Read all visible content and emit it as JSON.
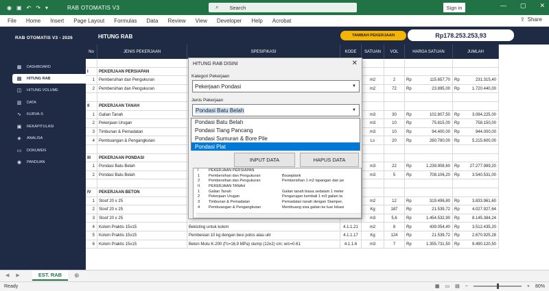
{
  "titlebar": {
    "app_title": "RAB OTOMATIS V3",
    "search_placeholder": "Search",
    "signin_label": "Sign in",
    "min_glyph": "—",
    "max_glyph": "▢",
    "close_glyph": "✕"
  },
  "menu": [
    "File",
    "Home",
    "Insert",
    "Page Layout",
    "Formulas",
    "Data",
    "Review",
    "View",
    "Developer",
    "Help",
    "Acrobat"
  ],
  "share_label": "Share",
  "sidebar": {
    "title": "RAB OTOMATIS V3 - 2026",
    "items": [
      {
        "label": "DASHBOARD",
        "icon": "dashboard-icon",
        "glyph": "▦"
      },
      {
        "label": "HITUNG RAB",
        "icon": "calculator-icon",
        "glyph": "▤"
      },
      {
        "label": "HITUNG VOLUME",
        "icon": "cube-icon",
        "glyph": "◫"
      },
      {
        "label": "DATA",
        "icon": "database-icon",
        "glyph": "▥"
      },
      {
        "label": "KURVA-S",
        "icon": "chart-icon",
        "glyph": "∿"
      },
      {
        "label": "REKAPITULASI",
        "icon": "summary-icon",
        "glyph": "▣"
      },
      {
        "label": "ANALISA",
        "icon": "analysis-icon",
        "glyph": "◈"
      },
      {
        "label": "DOKUMEN",
        "icon": "document-icon",
        "glyph": "▭"
      },
      {
        "label": "PANDUAN",
        "icon": "help-icon",
        "glyph": "◉"
      }
    ]
  },
  "header": {
    "title": "HITUNG RAB",
    "tambah_label": "TAMBAH PEKERJAAN",
    "total": "Rp178.253.253,93"
  },
  "columns": {
    "no": "No",
    "jenis": "JENIS PEKERJAAN",
    "spek": "SPESIFIKASI",
    "kode": "KODE",
    "satuan": "SATUAN",
    "vol": "VOL",
    "harga": "HARGA SATUAN",
    "jumlah": "JUMLAH"
  },
  "rows": [
    {
      "no": "",
      "jenis": "",
      "spek": "",
      "kode": "",
      "sat": "",
      "vol": "",
      "rp1": "",
      "harga": "",
      "rp2": "",
      "jumlah": ""
    },
    {
      "no": "I",
      "jenis": "PEKERJAAN PERSIAPAN",
      "section": true
    },
    {
      "no": "1",
      "jenis": "Pembersihan dan Pengukuran",
      "spek": "",
      "kode": "",
      "sat": "m2",
      "vol": "2",
      "rp1": "Rp",
      "harga": "115.657,70",
      "rp2": "Rp",
      "jumlah": "231.315,40"
    },
    {
      "no": "2",
      "jenis": "Pembersihan dan Pengukuran",
      "spek": "",
      "kode": "",
      "sat": "m2",
      "vol": "72",
      "rp1": "Rp",
      "harga": "23.895,00",
      "rp2": "Rp",
      "jumlah": "1.720.440,00"
    },
    {
      "no": "",
      "jenis": "",
      "spek": "",
      "kode": "",
      "sat": "",
      "vol": "",
      "rp1": "",
      "harga": "",
      "rp2": "",
      "jumlah": ""
    },
    {
      "no": "II",
      "jenis": "PEKERJAAN TANAH",
      "section": true
    },
    {
      "no": "1",
      "jenis": "Galian Tanah",
      "spek": "",
      "kode": "",
      "sat": "m3",
      "vol": "30",
      "rp1": "Rp",
      "harga": "102.807,50",
      "rp2": "Rp",
      "jumlah": "3.084.225,00"
    },
    {
      "no": "2",
      "jenis": "Pekerjaan Urugan",
      "spek": "",
      "kode": "",
      "sat": "m3",
      "vol": "10",
      "rp1": "Rp",
      "harga": "75.815,00",
      "rp2": "Rp",
      "jumlah": "758.150,00"
    },
    {
      "no": "3",
      "jenis": "Timbunan & Pemadatan",
      "spek": "",
      "kode": "",
      "sat": "m3",
      "vol": "10",
      "rp1": "Rp",
      "harga": "94.400,00",
      "rp2": "Rp",
      "jumlah": "944.000,00"
    },
    {
      "no": "4",
      "jenis": "Pembuangan & Pengangkutan",
      "spek": "",
      "kode": "",
      "sat": "Ls",
      "vol": "20",
      "rp1": "Rp",
      "harga": "260.780,00",
      "rp2": "Rp",
      "jumlah": "5.215.600,00"
    },
    {
      "no": "",
      "jenis": "",
      "spek": "",
      "kode": "",
      "sat": "",
      "vol": "",
      "rp1": "",
      "harga": "",
      "rp2": "",
      "jumlah": ""
    },
    {
      "no": "III",
      "jenis": "PEKERJAAN PONDASI",
      "section": true
    },
    {
      "no": "1",
      "jenis": "Pondasi Batu Belah",
      "spek": "",
      "kode": "",
      "sat": "m3",
      "vol": "22",
      "rp1": "Rp",
      "harga": "1.239.908,60",
      "rp2": "Rp",
      "jumlah": "27.277.989,20"
    },
    {
      "no": "2",
      "jenis": "Pondasi Batu Belah",
      "spek": "",
      "kode": "",
      "sat": "m3",
      "vol": "5",
      "rp1": "Rp",
      "harga": "708.106,20",
      "rp2": "Rp",
      "jumlah": "3.540.531,00"
    },
    {
      "no": "",
      "jenis": "",
      "spek": "",
      "kode": "",
      "sat": "",
      "vol": "",
      "rp1": "",
      "harga": "",
      "rp2": "",
      "jumlah": ""
    },
    {
      "no": "IV",
      "jenis": "PEKERJAAN BETON",
      "section": true
    },
    {
      "no": "1",
      "jenis": "Sloof  20 x 25",
      "spek": "",
      "kode": "",
      "sat": "m2",
      "vol": "12",
      "rp1": "Rp",
      "harga": "319.496,80",
      "rp2": "Rp",
      "jumlah": "3.833.961,60"
    },
    {
      "no": "2",
      "jenis": "Sloof  20 x 25",
      "spek": "",
      "kode": "",
      "sat": "Kg",
      "vol": "187",
      "rp1": "Rp",
      "harga": "21.539,72",
      "rp2": "Rp",
      "jumlah": "4.027.927,64"
    },
    {
      "no": "3",
      "jenis": "Sloof  20 x 25",
      "spek": "",
      "kode": "",
      "sat": "m3",
      "vol": "5,6",
      "rp1": "Rp",
      "harga": "1.454.532,90",
      "rp2": "Rp",
      "jumlah": "8.145.384,24"
    },
    {
      "no": "4",
      "jenis": "Kolom Praktis 15x15",
      "spek": "Bekisting untuk kolom",
      "kode": "4.1.1.21",
      "sat": "m2",
      "vol": "8",
      "rp1": "Rp",
      "harga": "439.054,40",
      "rp2": "Rp",
      "jumlah": "3.512.435,20"
    },
    {
      "no": "5",
      "jenis": "Kolom Praktis 15x15",
      "spek": "Pembesian 10 kg dengan besi polos atau ulir",
      "kode": "4.1.1.17",
      "sat": "Kg",
      "vol": "124",
      "rp1": "Rp",
      "harga": "21.539,72",
      "rp2": "Rp",
      "jumlah": "2.670.925,28"
    },
    {
      "no": "6",
      "jenis": "Kolom Praktis 15x15",
      "spek": "Beton Mutu K-200 (f'c=16,9 MPa) slump (12±2) cm; w/c=0.61",
      "kode": "4.1.1.6",
      "sat": "m3",
      "vol": "7",
      "rp1": "Rp",
      "harga": "1.355.731,50",
      "rp2": "Rp",
      "jumlah": "9.490.120,50"
    }
  ],
  "dialog": {
    "title": "HITUNG RAB DISINI",
    "close_glyph": "✕",
    "kategori_label": "Kategori Pekerjaan",
    "kategori_value": "Pekerjaan Pondasi",
    "jenis_label": "Jenis Pekerjaan",
    "jenis_value": "Pondasi Batu Belah",
    "options": [
      "Pondasi Batu Belah",
      "Pondasi Tiang Pancang",
      "Pondasi Sumuran & Bore Pile",
      "Pondasi Plat"
    ],
    "selected_option": 3,
    "input_label": "INPUT DATA",
    "hapus_label": "HAPUS DATA",
    "preview": [
      {
        "a": "I",
        "b": "PEKERJAAN PERSIAPAN",
        "c": ""
      },
      {
        "a": "1",
        "b": "Pembersihan dan Pengukuran",
        "c": "Bouwplank"
      },
      {
        "a": "2",
        "b": "Pembersihan dan Pengukuran",
        "c": "Pembersihan 1 m2 lapangan dan pe"
      },
      {
        "a": "II",
        "b": "PEKERJAAN TANAH",
        "c": ""
      },
      {
        "a": "1",
        "b": "Galian Tanah",
        "c": "Galian tanah biasa sedalam 1 meter"
      },
      {
        "a": "2",
        "b": "Pekerjaan Urugan",
        "c": "Pengurugan kembali 1 m3 galian ta"
      },
      {
        "a": "3",
        "b": "Timbunan & Pemadatan",
        "c": "Pemadatan tanah dengan Stamper,"
      },
      {
        "a": "4",
        "b": "Pembuangan & Pengangkutan",
        "c": "Membuang sisa galian ke luar lokasi"
      },
      {
        "a": "",
        "b": "",
        "c": ""
      }
    ]
  },
  "sheet_tab": "EST. RAB",
  "status": {
    "ready": "Ready",
    "zoom": "80%"
  },
  "colors": {
    "excel_green": "#217346",
    "navy": "#1f2a44",
    "accent_yellow": "#f4b400",
    "selection_blue": "#0078d7"
  }
}
